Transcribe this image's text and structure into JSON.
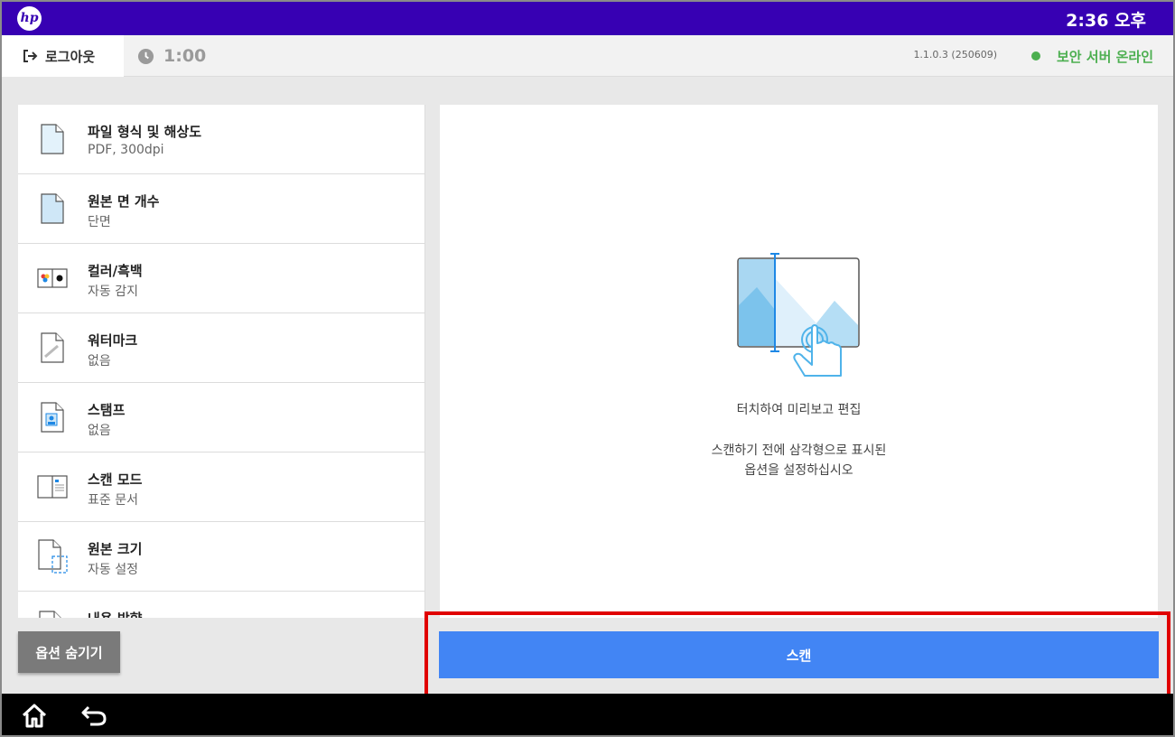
{
  "topbar": {
    "logo_text": "hp",
    "clock": "2:36 오후"
  },
  "subbar": {
    "logout_label": "로그아웃",
    "timer": "1:00",
    "version": "1.1.0.3 (250609)",
    "status": "보안 서버 온라인"
  },
  "options": [
    {
      "title": "파일 형식 및 해상도",
      "value": "PDF, 300dpi",
      "icon": "file-format-icon"
    },
    {
      "title": "원본 면 개수",
      "value": "단면",
      "icon": "single-side-icon"
    },
    {
      "title": "컬러/흑백",
      "value": "자동 감지",
      "icon": "color-mode-icon"
    },
    {
      "title": "워터마크",
      "value": "없음",
      "icon": "watermark-icon"
    },
    {
      "title": "스탬프",
      "value": "없음",
      "icon": "stamp-icon"
    },
    {
      "title": "스캔 모드",
      "value": "표준 문서",
      "icon": "scan-mode-icon"
    },
    {
      "title": "원본 크기",
      "value": "자동 설정",
      "icon": "original-size-icon"
    },
    {
      "title": "내용 방향",
      "value": "",
      "icon": "orientation-icon"
    }
  ],
  "preview": {
    "title": "터치하여 미리보고 편집",
    "desc_line1": "스캔하기 전에 삼각형으로 표시된",
    "desc_line2": "옵션을 설정하십시오"
  },
  "actions": {
    "hide_options": "옵션 숨기기",
    "scan": "스캔"
  },
  "colors": {
    "topbar": "#3700b3",
    "scan_button": "#4285f4",
    "status_green": "#4caf50",
    "highlight": "#e00000"
  }
}
